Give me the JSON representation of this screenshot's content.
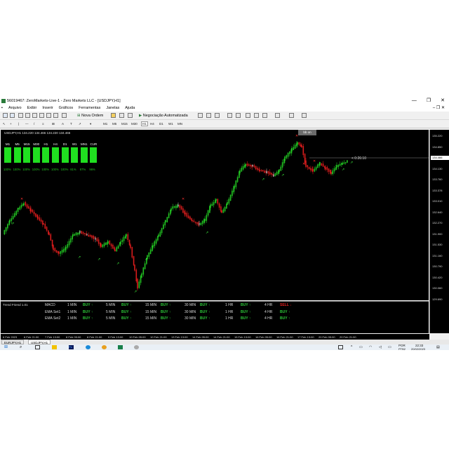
{
  "window": {
    "title": "56019467: ZeroMarkets-Live-1 - Zero Markets LLC - [USDJPY,H1]",
    "controls": [
      "—",
      "❐",
      "✕"
    ]
  },
  "menu": [
    "Arquivo",
    "Exibir",
    "Inserir",
    "Gráficos",
    "Ferramentas",
    "Janelas",
    "Ajuda"
  ],
  "toolbar": {
    "new_order": "Nova Ordem",
    "algo_trading": "Negociação Automatizada"
  },
  "timeframes": [
    "M1",
    "M5",
    "M15",
    "M30",
    "H1",
    "H4",
    "D1",
    "W1",
    "MN"
  ],
  "chart": {
    "label": "USDJPY,H1  134.220 134.466 134.220 134.466",
    "bb_label": "bb on",
    "timer": "< 0:26:10",
    "price_tag": "134.466",
    "price_levels": [
      "135.220",
      "134.850",
      "134.466",
      "134.130",
      "133.760",
      "133.378",
      "133.010",
      "132.640",
      "132.270",
      "131.900",
      "131.530",
      "131.160",
      "130.790",
      "130.420",
      "130.060",
      "129.690"
    ],
    "mtf": [
      {
        "tf": "M1",
        "pct": "100%"
      },
      {
        "tf": "M5",
        "pct": "100%"
      },
      {
        "tf": "M15",
        "pct": "100%"
      },
      {
        "tf": "M30",
        "pct": "100%"
      },
      {
        "tf": "H1",
        "pct": "100%"
      },
      {
        "tf": "H4",
        "pct": "100%"
      },
      {
        "tf": "D1",
        "pct": "100%"
      },
      {
        "tf": "W1",
        "pct": "81%"
      },
      {
        "tf": "MN1",
        "pct": "87%"
      },
      {
        "tf": "CUR",
        "pct": "96%"
      }
    ]
  },
  "indicator": {
    "title": "Trend Friend 1.01",
    "rows": [
      {
        "name": "MACD",
        "cells": [
          {
            "tf": "1 MIN",
            "signal": "BUY ↑",
            "type": "buy"
          },
          {
            "tf": "5 MIN",
            "signal": "BUY ↑",
            "type": "buy"
          },
          {
            "tf": "15 MIN",
            "signal": "BUY ↑",
            "type": "buy"
          },
          {
            "tf": "30 MIN",
            "signal": "BUY ↑",
            "type": "buy"
          },
          {
            "tf": "1 HR",
            "signal": "BUY ↑",
            "type": "buy"
          },
          {
            "tf": "4 HR",
            "signal": "SELL ↓",
            "type": "sell"
          }
        ]
      },
      {
        "name": "EMA Set1",
        "cells": [
          {
            "tf": "1 MIN",
            "signal": "BUY ↑",
            "type": "buy"
          },
          {
            "tf": "5 MIN",
            "signal": "BUY ↑",
            "type": "buy"
          },
          {
            "tf": "15 MIN",
            "signal": "BUY ↑",
            "type": "buy"
          },
          {
            "tf": "30 MIN",
            "signal": "BUY ↑",
            "type": "buy"
          },
          {
            "tf": "1 HR",
            "signal": "BUY ↑",
            "type": "buy"
          },
          {
            "tf": "4 HR",
            "signal": "BUY ↑",
            "type": "buy"
          }
        ]
      },
      {
        "name": "EMA Set2",
        "cells": [
          {
            "tf": "1 MIN",
            "signal": "BUY ↑",
            "type": "buy"
          },
          {
            "tf": "5 MIN",
            "signal": "BUY ↑",
            "type": "buy"
          },
          {
            "tf": "15 MIN",
            "signal": "BUY ↑",
            "type": "buy"
          },
          {
            "tf": "30 MIN",
            "signal": "BUY ↑",
            "type": "buy"
          },
          {
            "tf": "1 HR",
            "signal": "BUY ↑",
            "type": "buy"
          },
          {
            "tf": "4 HR",
            "signal": "BUY ↑",
            "type": "buy"
          }
        ]
      }
    ]
  },
  "time_axis": [
    "6 Feb 2023",
    "6 Feb 21:00",
    "7 Feb 13:00",
    "8 Feb 05:00",
    "8 Feb 21:00",
    "9 Feb 13:00",
    "10 Feb 05:00",
    "10 Feb 21:00",
    "13 Feb 13:00",
    "14 Feb 05:00",
    "14 Feb 21:00",
    "15 Feb 13:00",
    "16 Feb 05:00",
    "16 Feb 21:00",
    "17 Feb 13:00",
    "20 Feb 05:00",
    "20 Feb 21:00"
  ],
  "tabs": [
    "EURJPY,H1",
    "USDJPY,H1"
  ],
  "taskbar": {
    "lang": "POR",
    "layout": "PTB2",
    "time": "22:33",
    "date": "20/02/2023"
  },
  "colors": {
    "bull": "#22c522",
    "bear": "#d81c1c",
    "neutral": "#a0a0a0",
    "mtf_box": "#20e020"
  }
}
